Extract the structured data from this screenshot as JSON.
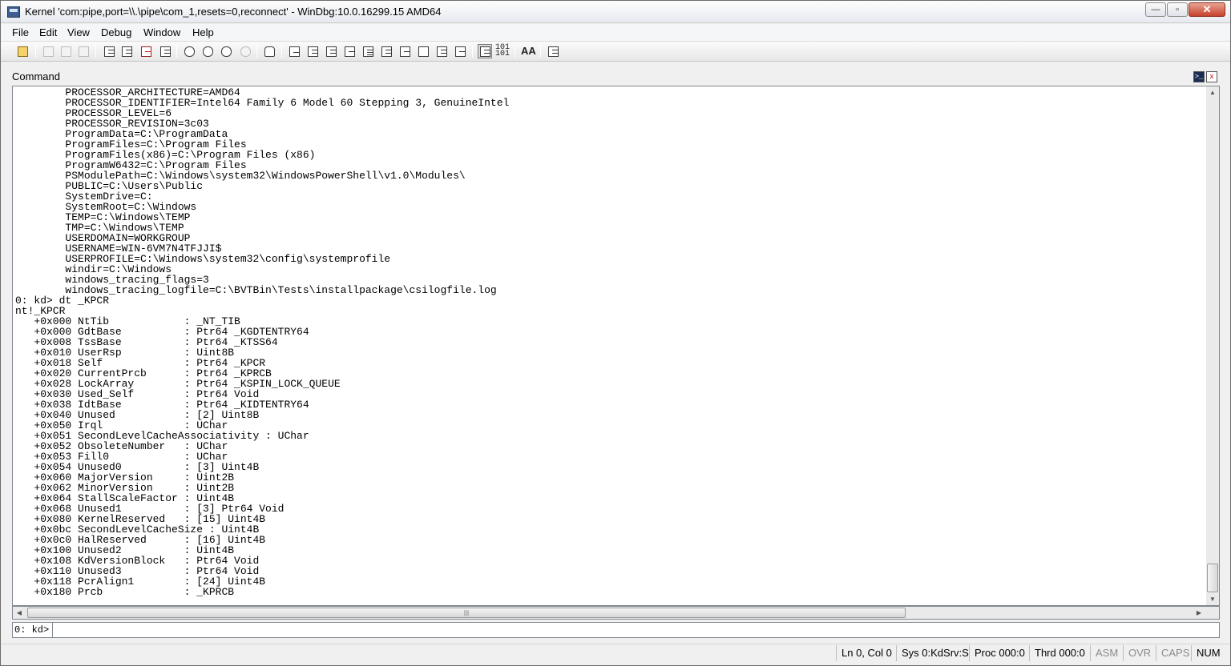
{
  "window": {
    "title": "Kernel 'com:pipe,port=\\\\.\\pipe\\com_1,resets=0,reconnect' - WinDbg:10.0.16299.15 AMD64",
    "minimize": "—",
    "maximize": "▫",
    "close": "✕"
  },
  "menu": {
    "file": "File",
    "edit": "Edit",
    "view": "View",
    "debug": "Debug",
    "window": "Window",
    "help": "Help"
  },
  "toolbar": {
    "source_mode_text": "101\n101",
    "font_text": "AA"
  },
  "panel": {
    "title": "Command",
    "dock_icon_glyph": ">_",
    "close_icon_glyph": "x"
  },
  "output_lines": [
    "        PROCESSOR_ARCHITECTURE=AMD64",
    "        PROCESSOR_IDENTIFIER=Intel64 Family 6 Model 60 Stepping 3, GenuineIntel",
    "        PROCESSOR_LEVEL=6",
    "        PROCESSOR_REVISION=3c03",
    "        ProgramData=C:\\ProgramData",
    "        ProgramFiles=C:\\Program Files",
    "        ProgramFiles(x86)=C:\\Program Files (x86)",
    "        ProgramW6432=C:\\Program Files",
    "        PSModulePath=C:\\Windows\\system32\\WindowsPowerShell\\v1.0\\Modules\\",
    "        PUBLIC=C:\\Users\\Public",
    "        SystemDrive=C:",
    "        SystemRoot=C:\\Windows",
    "        TEMP=C:\\Windows\\TEMP",
    "        TMP=C:\\Windows\\TEMP",
    "        USERDOMAIN=WORKGROUP",
    "        USERNAME=WIN-6VM7N4TFJJI$",
    "        USERPROFILE=C:\\Windows\\system32\\config\\systemprofile",
    "        windir=C:\\Windows",
    "        windows_tracing_flags=3",
    "        windows_tracing_logfile=C:\\BVTBin\\Tests\\installpackage\\csilogfile.log",
    "0: kd> dt _KPCR",
    "nt!_KPCR",
    "   +0x000 NtTib            : _NT_TIB",
    "   +0x000 GdtBase          : Ptr64 _KGDTENTRY64",
    "   +0x008 TssBase          : Ptr64 _KTSS64",
    "   +0x010 UserRsp          : Uint8B",
    "   +0x018 Self             : Ptr64 _KPCR",
    "   +0x020 CurrentPrcb      : Ptr64 _KPRCB",
    "   +0x028 LockArray        : Ptr64 _KSPIN_LOCK_QUEUE",
    "   +0x030 Used_Self        : Ptr64 Void",
    "   +0x038 IdtBase          : Ptr64 _KIDTENTRY64",
    "   +0x040 Unused           : [2] Uint8B",
    "   +0x050 Irql             : UChar",
    "   +0x051 SecondLevelCacheAssociativity : UChar",
    "   +0x052 ObsoleteNumber   : UChar",
    "   +0x053 Fill0            : UChar",
    "   +0x054 Unused0          : [3] Uint4B",
    "   +0x060 MajorVersion     : Uint2B",
    "   +0x062 MinorVersion     : Uint2B",
    "   +0x064 StallScaleFactor : Uint4B",
    "   +0x068 Unused1          : [3] Ptr64 Void",
    "   +0x080 KernelReserved   : [15] Uint4B",
    "   +0x0bc SecondLevelCacheSize : Uint4B",
    "   +0x0c0 HalReserved      : [16] Uint4B",
    "   +0x100 Unused2          : Uint4B",
    "   +0x108 KdVersionBlock   : Ptr64 Void",
    "   +0x110 Unused3          : Ptr64 Void",
    "   +0x118 PcrAlign1        : [24] Uint4B",
    "   +0x180 Prcb             : _KPRCB"
  ],
  "command": {
    "prompt": "0: kd>",
    "value": ""
  },
  "status": {
    "position": "Ln 0, Col 0",
    "sys": "Sys 0:KdSrv:S",
    "proc": "Proc 000:0",
    "thread": "Thrd 000:0",
    "asm": "ASM",
    "ovr": "OVR",
    "caps": "CAPS",
    "num": "NUM"
  },
  "scroll": {
    "up_arrow": "▲",
    "down_arrow": "▼",
    "left_arrow": "◀",
    "right_arrow": "▶",
    "grip": "|||"
  }
}
